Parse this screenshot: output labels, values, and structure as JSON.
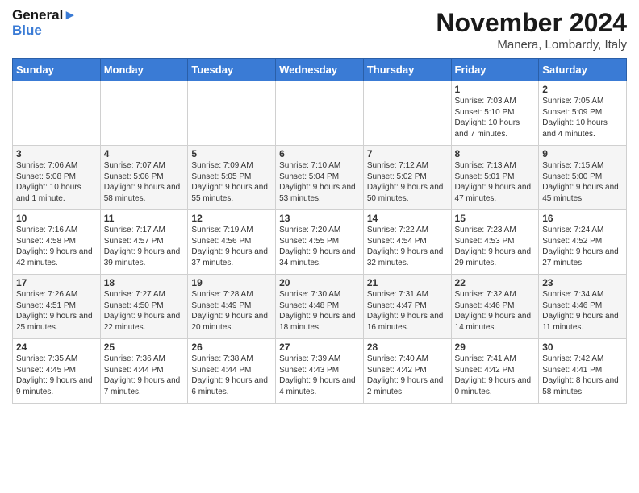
{
  "header": {
    "logo_text_part1": "General",
    "logo_text_part2": "Blue",
    "month_title": "November 2024",
    "subtitle": "Manera, Lombardy, Italy"
  },
  "weekdays": [
    "Sunday",
    "Monday",
    "Tuesday",
    "Wednesday",
    "Thursday",
    "Friday",
    "Saturday"
  ],
  "weeks": [
    [
      {
        "day": "",
        "info": ""
      },
      {
        "day": "",
        "info": ""
      },
      {
        "day": "",
        "info": ""
      },
      {
        "day": "",
        "info": ""
      },
      {
        "day": "",
        "info": ""
      },
      {
        "day": "1",
        "info": "Sunrise: 7:03 AM\nSunset: 5:10 PM\nDaylight: 10 hours and 7 minutes."
      },
      {
        "day": "2",
        "info": "Sunrise: 7:05 AM\nSunset: 5:09 PM\nDaylight: 10 hours and 4 minutes."
      }
    ],
    [
      {
        "day": "3",
        "info": "Sunrise: 7:06 AM\nSunset: 5:08 PM\nDaylight: 10 hours and 1 minute."
      },
      {
        "day": "4",
        "info": "Sunrise: 7:07 AM\nSunset: 5:06 PM\nDaylight: 9 hours and 58 minutes."
      },
      {
        "day": "5",
        "info": "Sunrise: 7:09 AM\nSunset: 5:05 PM\nDaylight: 9 hours and 55 minutes."
      },
      {
        "day": "6",
        "info": "Sunrise: 7:10 AM\nSunset: 5:04 PM\nDaylight: 9 hours and 53 minutes."
      },
      {
        "day": "7",
        "info": "Sunrise: 7:12 AM\nSunset: 5:02 PM\nDaylight: 9 hours and 50 minutes."
      },
      {
        "day": "8",
        "info": "Sunrise: 7:13 AM\nSunset: 5:01 PM\nDaylight: 9 hours and 47 minutes."
      },
      {
        "day": "9",
        "info": "Sunrise: 7:15 AM\nSunset: 5:00 PM\nDaylight: 9 hours and 45 minutes."
      }
    ],
    [
      {
        "day": "10",
        "info": "Sunrise: 7:16 AM\nSunset: 4:58 PM\nDaylight: 9 hours and 42 minutes."
      },
      {
        "day": "11",
        "info": "Sunrise: 7:17 AM\nSunset: 4:57 PM\nDaylight: 9 hours and 39 minutes."
      },
      {
        "day": "12",
        "info": "Sunrise: 7:19 AM\nSunset: 4:56 PM\nDaylight: 9 hours and 37 minutes."
      },
      {
        "day": "13",
        "info": "Sunrise: 7:20 AM\nSunset: 4:55 PM\nDaylight: 9 hours and 34 minutes."
      },
      {
        "day": "14",
        "info": "Sunrise: 7:22 AM\nSunset: 4:54 PM\nDaylight: 9 hours and 32 minutes."
      },
      {
        "day": "15",
        "info": "Sunrise: 7:23 AM\nSunset: 4:53 PM\nDaylight: 9 hours and 29 minutes."
      },
      {
        "day": "16",
        "info": "Sunrise: 7:24 AM\nSunset: 4:52 PM\nDaylight: 9 hours and 27 minutes."
      }
    ],
    [
      {
        "day": "17",
        "info": "Sunrise: 7:26 AM\nSunset: 4:51 PM\nDaylight: 9 hours and 25 minutes."
      },
      {
        "day": "18",
        "info": "Sunrise: 7:27 AM\nSunset: 4:50 PM\nDaylight: 9 hours and 22 minutes."
      },
      {
        "day": "19",
        "info": "Sunrise: 7:28 AM\nSunset: 4:49 PM\nDaylight: 9 hours and 20 minutes."
      },
      {
        "day": "20",
        "info": "Sunrise: 7:30 AM\nSunset: 4:48 PM\nDaylight: 9 hours and 18 minutes."
      },
      {
        "day": "21",
        "info": "Sunrise: 7:31 AM\nSunset: 4:47 PM\nDaylight: 9 hours and 16 minutes."
      },
      {
        "day": "22",
        "info": "Sunrise: 7:32 AM\nSunset: 4:46 PM\nDaylight: 9 hours and 14 minutes."
      },
      {
        "day": "23",
        "info": "Sunrise: 7:34 AM\nSunset: 4:46 PM\nDaylight: 9 hours and 11 minutes."
      }
    ],
    [
      {
        "day": "24",
        "info": "Sunrise: 7:35 AM\nSunset: 4:45 PM\nDaylight: 9 hours and 9 minutes."
      },
      {
        "day": "25",
        "info": "Sunrise: 7:36 AM\nSunset: 4:44 PM\nDaylight: 9 hours and 7 minutes."
      },
      {
        "day": "26",
        "info": "Sunrise: 7:38 AM\nSunset: 4:44 PM\nDaylight: 9 hours and 6 minutes."
      },
      {
        "day": "27",
        "info": "Sunrise: 7:39 AM\nSunset: 4:43 PM\nDaylight: 9 hours and 4 minutes."
      },
      {
        "day": "28",
        "info": "Sunrise: 7:40 AM\nSunset: 4:42 PM\nDaylight: 9 hours and 2 minutes."
      },
      {
        "day": "29",
        "info": "Sunrise: 7:41 AM\nSunset: 4:42 PM\nDaylight: 9 hours and 0 minutes."
      },
      {
        "day": "30",
        "info": "Sunrise: 7:42 AM\nSunset: 4:41 PM\nDaylight: 8 hours and 58 minutes."
      }
    ]
  ]
}
